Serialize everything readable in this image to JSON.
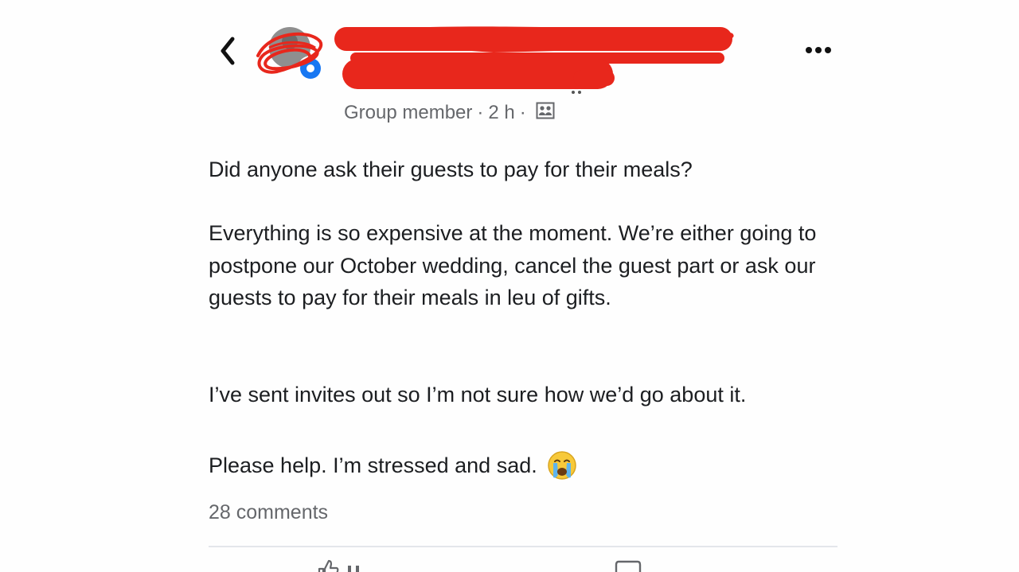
{
  "header": {
    "back_icon": "chevron-left-icon",
    "more_icon": "ellipsis-icon",
    "redaction_color": "#e8271c",
    "meta": {
      "role": "Group member",
      "separator": "·",
      "time": "2 h",
      "audience_icon": "group-icon"
    }
  },
  "post": {
    "paragraphs": [
      "Did anyone ask their guests to pay for their meals?",
      "Everything is so expensive at the moment. We’re either going to postpone our October wedding, cancel the guest part or ask our guests to pay for their meals in leu of gifts.",
      "I’ve sent invites out so I’m not sure how we’d go about it.",
      "Please help. I’m stressed and sad."
    ],
    "emoji": "crying-face-icon"
  },
  "footer": {
    "comments": "28 comments"
  },
  "actions": {
    "like_icon": "thumbs-up-icon",
    "comment_icon": "comment-bubble-icon"
  }
}
